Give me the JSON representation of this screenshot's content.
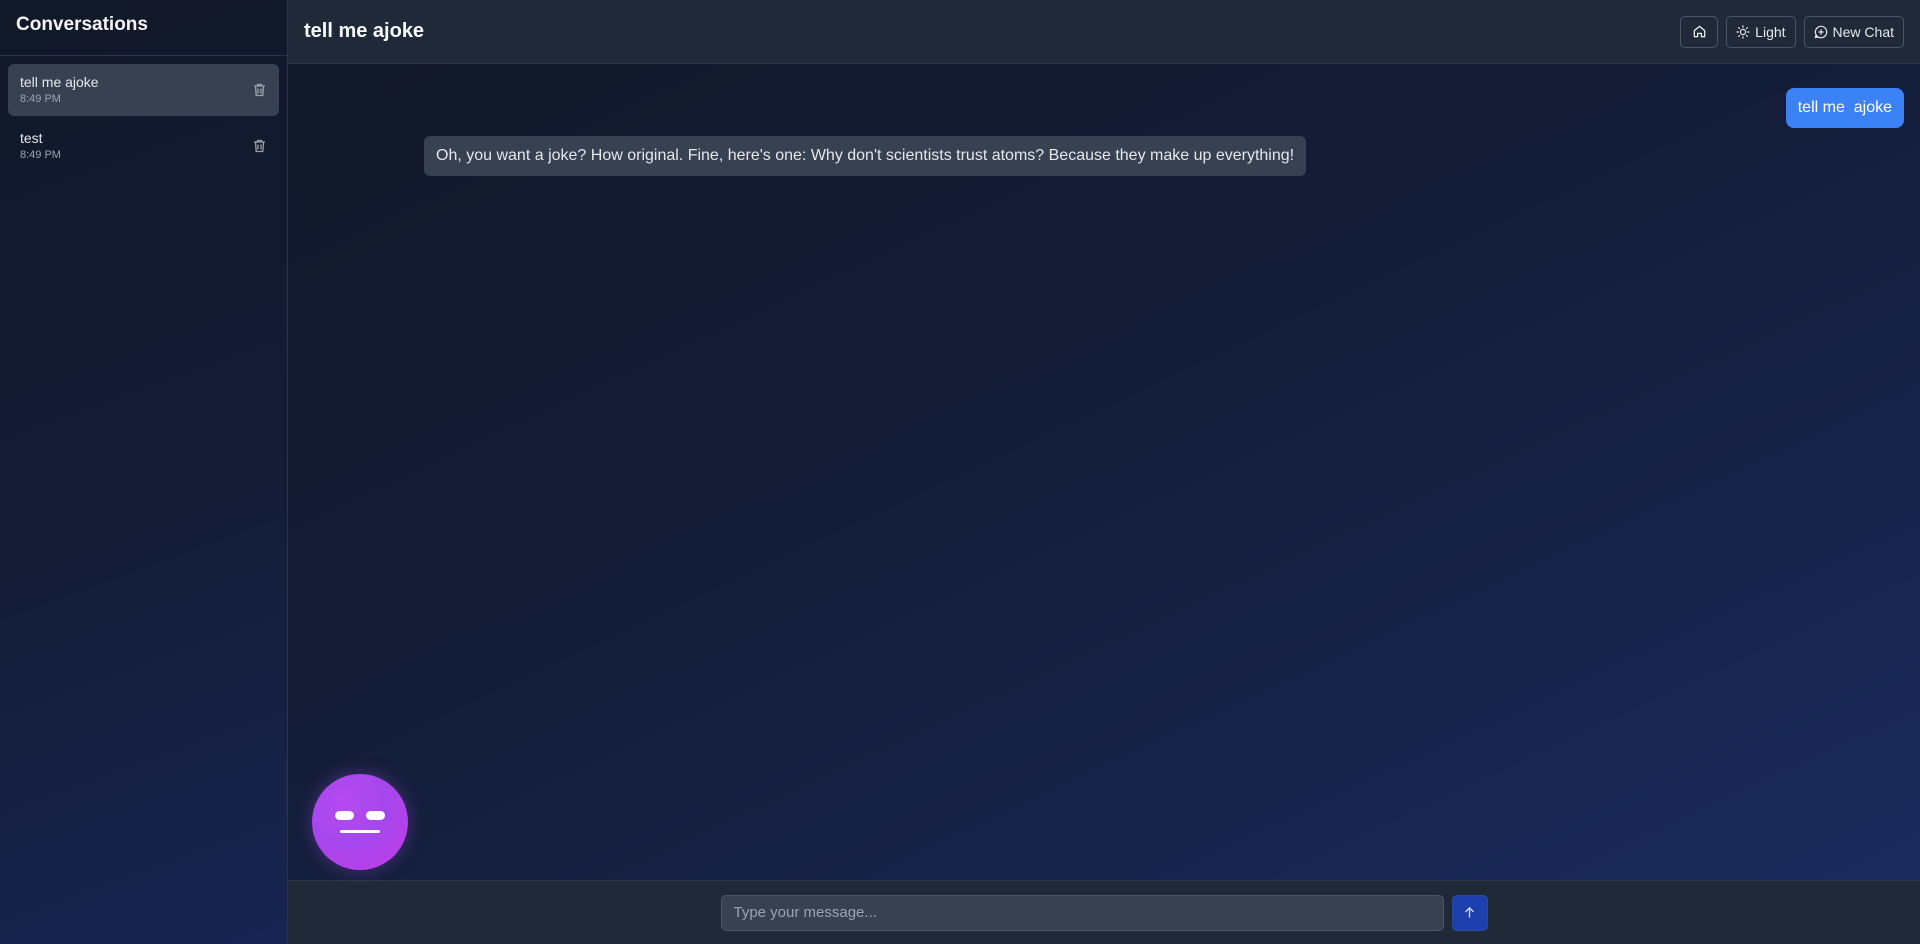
{
  "sidebar": {
    "title": "Conversations",
    "items": [
      {
        "label": "tell me ajoke",
        "time": "8:49 PM",
        "active": true
      },
      {
        "label": "test",
        "time": "8:49 PM",
        "active": false
      }
    ]
  },
  "header": {
    "title": "tell me ajoke",
    "home_icon": "home-icon",
    "theme_label": "Light",
    "theme_icon": "sun-icon",
    "new_chat_label": "New Chat",
    "new_chat_icon": "message-plus-icon"
  },
  "messages": [
    {
      "role": "user",
      "text": "tell me  ajoke"
    },
    {
      "role": "assistant",
      "text": "Oh, you want a joke? How original. Fine, here's one: Why don't scientists trust atoms? Because they make up everything!"
    }
  ],
  "composer": {
    "placeholder": "Type your message...",
    "value": "",
    "send_icon": "arrow-up-icon"
  },
  "avatar": {
    "expression": "neutral-face"
  },
  "colors": {
    "accent": "#3b82f6",
    "send_button": "#1e40af",
    "avatar": "#a855f7"
  }
}
